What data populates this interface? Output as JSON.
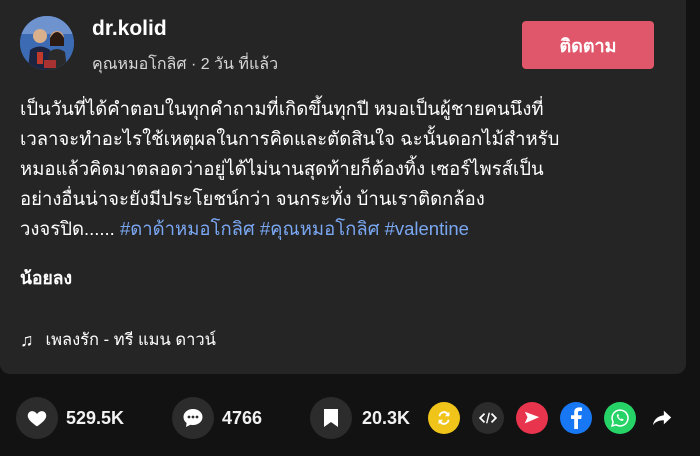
{
  "author": {
    "name": "dr.kolid",
    "meta": "คุณหมอโกลิศ · 2 วัน ที่แล้ว"
  },
  "follow_label": "ติดตาม",
  "description": {
    "line1": "เป็นวันที่ได้คำตอบในทุกคำถามที่เกิดขึ้นทุกปี หมอเป็นผู้ชายคนนึงที่",
    "line2": "เวลาจะทำอะไรใช้เหตุผลในการคิดและตัดสินใจ ฉะนั้นดอกไม้สำหรับ",
    "line3": "หมอแล้วคิดมาตลอดว่าอยู่ได้ไม่นานสุดท้ายก็ต้องทิ้ง เซอร์ไพรส์เป็น",
    "line4": "อย่างอื่นน่าจะยังมีประโยชน์กว่า จนกระทั่ง บ้านเราติดกล้อง",
    "line5_text": "วงจรปิด......",
    "hashtags": [
      "#ดาด้าหมอโกลิศ",
      "#คุณหมอโกลิศ",
      "#valentine"
    ]
  },
  "less_label": "น้อยลง",
  "music": {
    "icon": "music-note-icon",
    "title": "เพลงรัก - ทรี แมน ดาวน์"
  },
  "actions": {
    "likes": "529.5K",
    "comments": "4766",
    "saves": "20.3K"
  },
  "share_icons": [
    "repost-icon",
    "embed-icon",
    "send-icon",
    "facebook-icon",
    "whatsapp-icon",
    "share-arrow-icon"
  ],
  "colors": {
    "background": "#121212",
    "card": "#252525",
    "follow_button": "#e0566a",
    "hashtag": "#7aa7f2",
    "repost": "#f0c419",
    "send": "#e8344c",
    "facebook": "#1877f2",
    "whatsapp": "#25d366"
  }
}
